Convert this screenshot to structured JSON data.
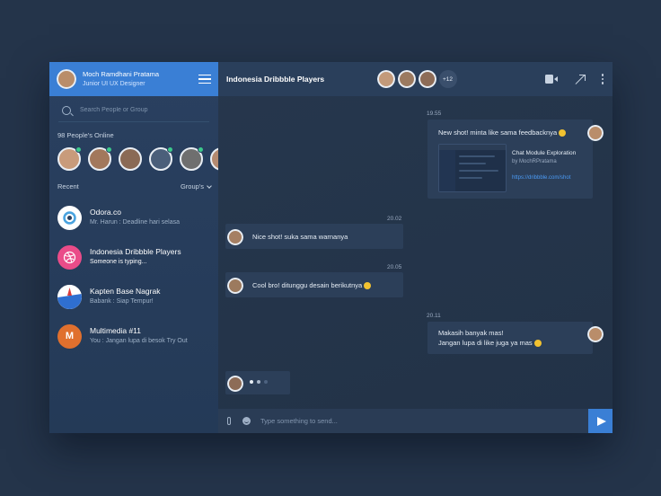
{
  "colors": {
    "accent": "#3a7fd5",
    "online": "#3cc98a",
    "link": "#4b9bf5"
  },
  "profile": {
    "name": "Moch Ramdhani Pratama",
    "role": "Junior UI UX Designer",
    "avatar_color": "#b98d6a"
  },
  "search": {
    "placeholder": "Search People or Group"
  },
  "online": {
    "title": "98 People's Online",
    "avatars": [
      "#c89b7b",
      "#a2785c",
      "#8a6a55",
      "#4b5f7a",
      "#6f6f6f",
      "#b48a70"
    ]
  },
  "recent": {
    "label": "Recent",
    "filter_label": "Group's"
  },
  "conversations": [
    {
      "name": "Odora.co",
      "last": "Mr. Harun : Deadline hari selasa",
      "logo": "odora-logo",
      "color": "#ffffff"
    },
    {
      "name": "Indonesia Dribbble Players",
      "last": "Someone is typing...",
      "logo": "dribbble-logo",
      "color": "#ea4c89"
    },
    {
      "name": "Kapten Base Nagrak",
      "last": "Babank : Siap Tempur!",
      "logo": "flag-logo",
      "color": "#ffffff"
    },
    {
      "name": "Multimedia #11",
      "last": "You : Jangan lupa di besok Try Out",
      "logo": "M",
      "color": "#e0702e"
    }
  ],
  "chat": {
    "title": "Indonesia Dribbble Players",
    "members_more": "+12",
    "member_avatars": [
      "#c39a7a",
      "#9b7a60",
      "#8d6c57"
    ],
    "messages": [
      {
        "time": "19.55",
        "text": "New shot! minta like sama feedbacknya",
        "card": {
          "title": "Chat Module Exploration",
          "author": "by MochRPratama",
          "link": "https://dribbble.com/shot"
        }
      },
      {
        "time": "20.02",
        "text": "Nice shot! suka sama warnanya"
      },
      {
        "time": "20.05",
        "text": "Cool bro! ditunggu desain berikutnya"
      },
      {
        "time": "20.11",
        "line1": "Makasih banyak mas!",
        "line2": "Jangan lupa di like juga ya mas"
      }
    ],
    "composer_placeholder": "Type something to send..."
  }
}
